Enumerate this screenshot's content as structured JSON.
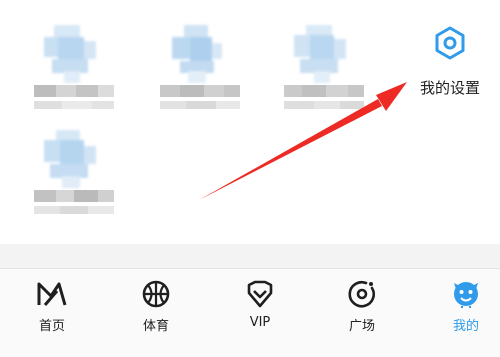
{
  "settings": {
    "label": "我的设置",
    "icon": "hexagon-settings-icon"
  },
  "tabbar": {
    "items": [
      {
        "label": "首页",
        "icon": "home-logo-icon",
        "active": false
      },
      {
        "label": "体育",
        "icon": "basketball-icon",
        "active": false
      },
      {
        "label": "VIP",
        "icon": "vip-shield-icon",
        "active": false
      },
      {
        "label": "广场",
        "icon": "plaza-ring-icon",
        "active": false
      },
      {
        "label": "我的",
        "icon": "smiley-mascot-icon",
        "active": true
      }
    ]
  },
  "colors": {
    "accent": "#2f9bea",
    "arrow": "#ee2a24"
  }
}
